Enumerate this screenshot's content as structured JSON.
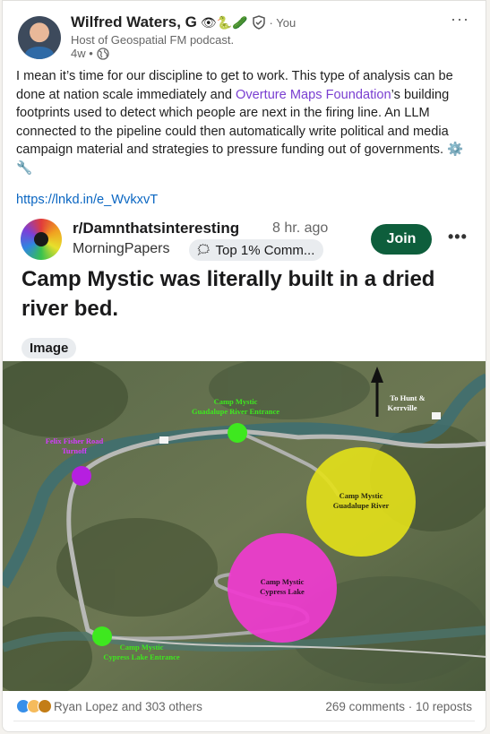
{
  "post": {
    "author": "Wilfred Waters, G",
    "author_emojis": "👁🐍🥒",
    "you_tag": "· You",
    "headline": "Host of Geospatial FM podcast.",
    "time": "4w •",
    "more": "···",
    "body_part1": "I mean it’s time for our discipline to get to work. This type of analysis can be done at nation scale immediately and ",
    "mention": "Overture Maps Foundation",
    "body_part2": "’s building footprints used to detect which people are next in the firing line. An LLM connected to the pipeline could then automatically write political and media campaign material and strategies to pressure funding out of governments. ⚙️ 🔧",
    "link": "https://lnkd.in/e_WvkxvT"
  },
  "embed": {
    "subreddit": "r/Damnthatsinteresting",
    "time": "8 hr. ago",
    "user": "MorningPapers",
    "badge": "Top 1% Comm...",
    "badge_icon": "🗯",
    "join": "Join",
    "more": "•••",
    "title": "Camp Mystic was literally built in a dried river bed.",
    "image_chip": "Image",
    "map": {
      "labels": {
        "guadalupe_entrance_1": "Camp Mystic",
        "guadalupe_entrance_2": "Guadalupe River Entrance",
        "felix_1": "Felix Fisher Road",
        "felix_2": "Turnoff",
        "hunt_1": "To Hunt &",
        "hunt_2": "Kerrville",
        "guadalupe_river_1": "Camp Mystic",
        "guadalupe_river_2": "Guadalupe River",
        "cypress_lake_1": "Camp Mystic",
        "cypress_lake_2": "Cypress Lake",
        "cypress_entrance_1": "Camp Mystic",
        "cypress_entrance_2": "Cypress Lake Entrance"
      },
      "colors": {
        "entrance": "#3ee81f",
        "turnoff": "#b61fe0",
        "guadalupe": "#e4e11a",
        "cypress": "#f03bd0"
      }
    }
  },
  "footer": {
    "reactions": "Ryan Lopez and 303 others",
    "comments": "269 comments",
    "separator": " · ",
    "reposts": "10 reposts"
  }
}
